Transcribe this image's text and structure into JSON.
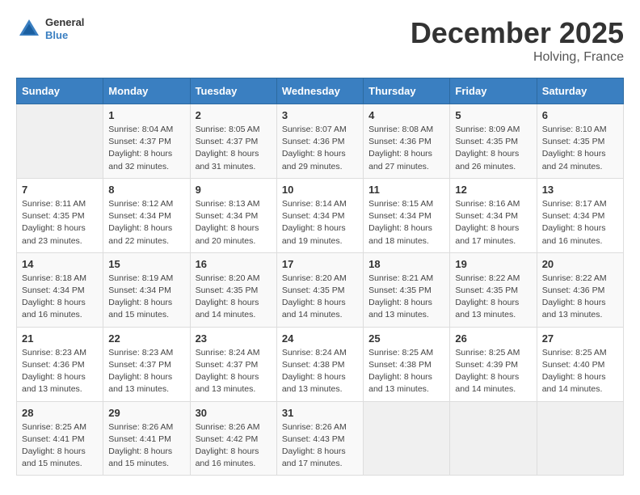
{
  "header": {
    "logo": {
      "general": "General",
      "blue": "Blue"
    },
    "month": "December 2025",
    "location": "Holving, France"
  },
  "weekdays": [
    "Sunday",
    "Monday",
    "Tuesday",
    "Wednesday",
    "Thursday",
    "Friday",
    "Saturday"
  ],
  "weeks": [
    [
      {
        "day": "",
        "info": ""
      },
      {
        "day": "1",
        "info": "Sunrise: 8:04 AM\nSunset: 4:37 PM\nDaylight: 8 hours\nand 32 minutes."
      },
      {
        "day": "2",
        "info": "Sunrise: 8:05 AM\nSunset: 4:37 PM\nDaylight: 8 hours\nand 31 minutes."
      },
      {
        "day": "3",
        "info": "Sunrise: 8:07 AM\nSunset: 4:36 PM\nDaylight: 8 hours\nand 29 minutes."
      },
      {
        "day": "4",
        "info": "Sunrise: 8:08 AM\nSunset: 4:36 PM\nDaylight: 8 hours\nand 27 minutes."
      },
      {
        "day": "5",
        "info": "Sunrise: 8:09 AM\nSunset: 4:35 PM\nDaylight: 8 hours\nand 26 minutes."
      },
      {
        "day": "6",
        "info": "Sunrise: 8:10 AM\nSunset: 4:35 PM\nDaylight: 8 hours\nand 24 minutes."
      }
    ],
    [
      {
        "day": "7",
        "info": "Sunrise: 8:11 AM\nSunset: 4:35 PM\nDaylight: 8 hours\nand 23 minutes."
      },
      {
        "day": "8",
        "info": "Sunrise: 8:12 AM\nSunset: 4:34 PM\nDaylight: 8 hours\nand 22 minutes."
      },
      {
        "day": "9",
        "info": "Sunrise: 8:13 AM\nSunset: 4:34 PM\nDaylight: 8 hours\nand 20 minutes."
      },
      {
        "day": "10",
        "info": "Sunrise: 8:14 AM\nSunset: 4:34 PM\nDaylight: 8 hours\nand 19 minutes."
      },
      {
        "day": "11",
        "info": "Sunrise: 8:15 AM\nSunset: 4:34 PM\nDaylight: 8 hours\nand 18 minutes."
      },
      {
        "day": "12",
        "info": "Sunrise: 8:16 AM\nSunset: 4:34 PM\nDaylight: 8 hours\nand 17 minutes."
      },
      {
        "day": "13",
        "info": "Sunrise: 8:17 AM\nSunset: 4:34 PM\nDaylight: 8 hours\nand 16 minutes."
      }
    ],
    [
      {
        "day": "14",
        "info": "Sunrise: 8:18 AM\nSunset: 4:34 PM\nDaylight: 8 hours\nand 16 minutes."
      },
      {
        "day": "15",
        "info": "Sunrise: 8:19 AM\nSunset: 4:34 PM\nDaylight: 8 hours\nand 15 minutes."
      },
      {
        "day": "16",
        "info": "Sunrise: 8:20 AM\nSunset: 4:35 PM\nDaylight: 8 hours\nand 14 minutes."
      },
      {
        "day": "17",
        "info": "Sunrise: 8:20 AM\nSunset: 4:35 PM\nDaylight: 8 hours\nand 14 minutes."
      },
      {
        "day": "18",
        "info": "Sunrise: 8:21 AM\nSunset: 4:35 PM\nDaylight: 8 hours\nand 13 minutes."
      },
      {
        "day": "19",
        "info": "Sunrise: 8:22 AM\nSunset: 4:35 PM\nDaylight: 8 hours\nand 13 minutes."
      },
      {
        "day": "20",
        "info": "Sunrise: 8:22 AM\nSunset: 4:36 PM\nDaylight: 8 hours\nand 13 minutes."
      }
    ],
    [
      {
        "day": "21",
        "info": "Sunrise: 8:23 AM\nSunset: 4:36 PM\nDaylight: 8 hours\nand 13 minutes."
      },
      {
        "day": "22",
        "info": "Sunrise: 8:23 AM\nSunset: 4:37 PM\nDaylight: 8 hours\nand 13 minutes."
      },
      {
        "day": "23",
        "info": "Sunrise: 8:24 AM\nSunset: 4:37 PM\nDaylight: 8 hours\nand 13 minutes."
      },
      {
        "day": "24",
        "info": "Sunrise: 8:24 AM\nSunset: 4:38 PM\nDaylight: 8 hours\nand 13 minutes."
      },
      {
        "day": "25",
        "info": "Sunrise: 8:25 AM\nSunset: 4:38 PM\nDaylight: 8 hours\nand 13 minutes."
      },
      {
        "day": "26",
        "info": "Sunrise: 8:25 AM\nSunset: 4:39 PM\nDaylight: 8 hours\nand 14 minutes."
      },
      {
        "day": "27",
        "info": "Sunrise: 8:25 AM\nSunset: 4:40 PM\nDaylight: 8 hours\nand 14 minutes."
      }
    ],
    [
      {
        "day": "28",
        "info": "Sunrise: 8:25 AM\nSunset: 4:41 PM\nDaylight: 8 hours\nand 15 minutes."
      },
      {
        "day": "29",
        "info": "Sunrise: 8:26 AM\nSunset: 4:41 PM\nDaylight: 8 hours\nand 15 minutes."
      },
      {
        "day": "30",
        "info": "Sunrise: 8:26 AM\nSunset: 4:42 PM\nDaylight: 8 hours\nand 16 minutes."
      },
      {
        "day": "31",
        "info": "Sunrise: 8:26 AM\nSunset: 4:43 PM\nDaylight: 8 hours\nand 17 minutes."
      },
      {
        "day": "",
        "info": ""
      },
      {
        "day": "",
        "info": ""
      },
      {
        "day": "",
        "info": ""
      }
    ]
  ]
}
